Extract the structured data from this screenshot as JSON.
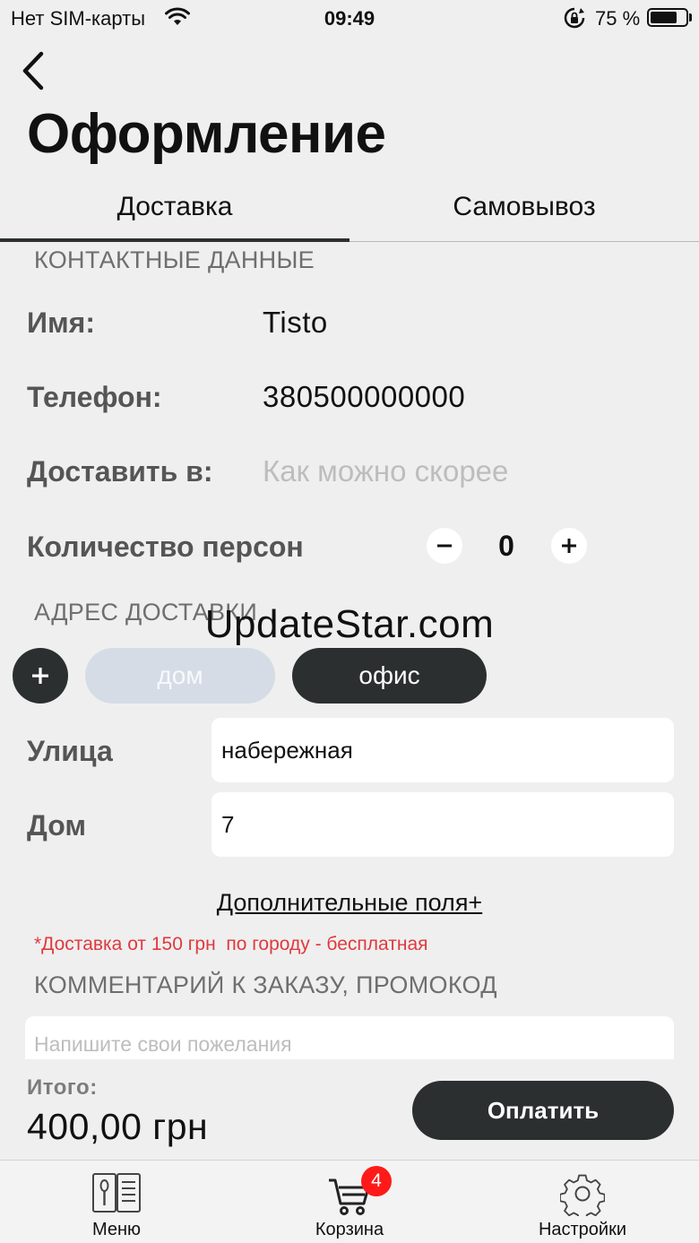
{
  "status_bar": {
    "carrier": "Нет SIM-карты",
    "time": "09:49",
    "battery_percent_text": "75 %",
    "battery_level": 0.75
  },
  "header": {
    "back_icon": "chevron-left-icon",
    "title": "Оформление"
  },
  "tabs": [
    {
      "label": "Доставка",
      "active": true
    },
    {
      "label": "Самовывоз",
      "active": false
    }
  ],
  "contact": {
    "section_title": "КОНТАКТНЫЕ ДАННЫЕ",
    "name_label": "Имя:",
    "name_value": "Tisto",
    "phone_label": "Телефон:",
    "phone_value": "380500000000",
    "deliver_label": "Доставить в:",
    "deliver_placeholder": "Как можно скорее",
    "persons_label": "Количество персон",
    "persons_value": "0",
    "minus_symbol": "−",
    "plus_symbol": "+"
  },
  "watermark": "UpdateStar.com",
  "address": {
    "section_title": "АДРЕС ДОСТАВКИ",
    "add_symbol": "+",
    "chips": [
      {
        "label": "дом",
        "selected": false
      },
      {
        "label": "офис",
        "selected": true
      }
    ],
    "street_label": "Улица",
    "street_value": "набережная",
    "house_label": "Дом",
    "house_value": "7",
    "extra_fields_link": "Дополнительные поля+",
    "delivery_note": "*Доставка от 150 грн  по городу - бесплатная"
  },
  "comment": {
    "section_title": "КОММЕНТАРИЙ К ЗАКАЗУ, ПРОМОКОД",
    "placeholder": "Напишите свои пожелания"
  },
  "checkout": {
    "total_label": "Итого:",
    "total_value": "400,00 грн",
    "pay_button": "Оплатить"
  },
  "tabbar": {
    "items": [
      {
        "label": "Меню",
        "icon": "menu-book-icon"
      },
      {
        "label": "Корзина",
        "icon": "cart-icon",
        "badge": "4"
      },
      {
        "label": "Настройки",
        "icon": "gear-icon"
      }
    ]
  },
  "colors": {
    "dark": "#2b2f2f",
    "accent_red": "#e0393e",
    "badge_red": "#ff1a1a",
    "chip_inactive": "#d6dce5",
    "background": "#efefef"
  }
}
